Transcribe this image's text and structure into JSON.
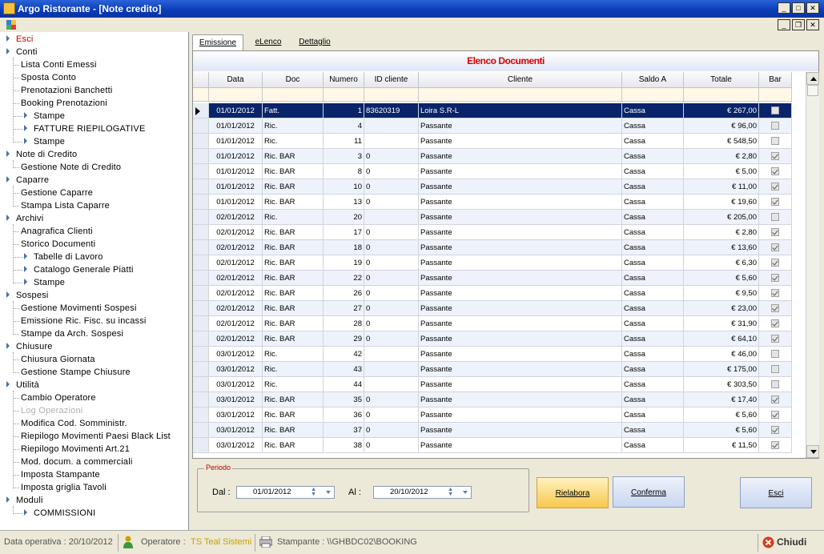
{
  "window": {
    "title": "Argo Ristorante - [Note credito]"
  },
  "sidebar": [
    {
      "label": "Esci",
      "level": 0,
      "arrow": true,
      "style": "red"
    },
    {
      "label": "Conti",
      "level": 0,
      "arrow": true
    },
    {
      "label": "Lista Conti Emessi",
      "level": 1
    },
    {
      "label": "Sposta Conto",
      "level": 1
    },
    {
      "label": "Prenotazioni Banchetti",
      "level": 1
    },
    {
      "label": "Booking Prenotazioni",
      "level": 1
    },
    {
      "label": "Stampe",
      "level": 2,
      "arrow": true
    },
    {
      "label": "FATTURE RIEPILOGATIVE",
      "level": 2,
      "arrow": true
    },
    {
      "label": "Stampe",
      "level": 2,
      "arrow": true
    },
    {
      "label": "Note di Credito",
      "level": 0,
      "arrow": true
    },
    {
      "label": "Gestione Note di Credito",
      "level": 1
    },
    {
      "label": "Caparre",
      "level": 0,
      "arrow": true
    },
    {
      "label": "Gestione Caparre",
      "level": 1
    },
    {
      "label": "Stampa Lista Caparre",
      "level": 1
    },
    {
      "label": "Archivi",
      "level": 0,
      "arrow": true
    },
    {
      "label": "Anagrafica Clienti",
      "level": 1
    },
    {
      "label": "Storico Documenti",
      "level": 1
    },
    {
      "label": "Tabelle di Lavoro",
      "level": 2,
      "arrow": true
    },
    {
      "label": "Catalogo Generale Piatti",
      "level": 2,
      "arrow": true
    },
    {
      "label": "Stampe",
      "level": 2,
      "arrow": true
    },
    {
      "label": "Sospesi",
      "level": 0,
      "arrow": true
    },
    {
      "label": "Gestione Movimenti Sospesi",
      "level": 1
    },
    {
      "label": "Emissione Ric. Fisc. su incassi",
      "level": 1
    },
    {
      "label": "Stampe da Arch. Sospesi",
      "level": 1
    },
    {
      "label": "Chiusure",
      "level": 0,
      "arrow": true
    },
    {
      "label": "Chiusura Giornata",
      "level": 1
    },
    {
      "label": "Gestione Stampe Chiusure",
      "level": 1
    },
    {
      "label": "Utilità",
      "level": 0,
      "arrow": true
    },
    {
      "label": "Cambio Operatore",
      "level": 1
    },
    {
      "label": "Log Operazioni",
      "level": 1,
      "style": "dim"
    },
    {
      "label": "Modifica Cod. Somministr.",
      "level": 1
    },
    {
      "label": "Riepilogo Movimenti Paesi Black List",
      "level": 1
    },
    {
      "label": "Riepilogo Movimenti Art.21",
      "level": 1
    },
    {
      "label": "Mod. docum. a commerciali",
      "level": 1
    },
    {
      "label": "Imposta Stampante",
      "level": 1
    },
    {
      "label": "Imposta griglia Tavoli",
      "level": 1
    },
    {
      "label": "Moduli",
      "level": 0,
      "arrow": true
    },
    {
      "label": "COMMISSIONI",
      "level": 2,
      "arrow": true
    }
  ],
  "tabs": [
    {
      "label": "Emissione",
      "active": true
    },
    {
      "label": "eLenco",
      "active": false
    },
    {
      "label": "Dettaglio",
      "active": false
    }
  ],
  "grid": {
    "title": "Elenco Documenti",
    "columns": [
      "Data",
      "Doc",
      "Numero",
      "ID cliente",
      "Cliente",
      "Saldo A",
      "Totale",
      "Bar"
    ],
    "rows": [
      {
        "data": "01/01/2012",
        "doc": "Fatt.",
        "numero": "1",
        "id": "83620319",
        "cliente": "Loira S.R-L",
        "saldo": "Cassa",
        "totale": "€ 267,00",
        "bar": false
      },
      {
        "data": "01/01/2012",
        "doc": "Ric.",
        "numero": "4",
        "id": "",
        "cliente": "Passante",
        "saldo": "Cassa",
        "totale": "€ 96,00",
        "bar": false
      },
      {
        "data": "01/01/2012",
        "doc": "Ric.",
        "numero": "11",
        "id": "",
        "cliente": "Passante",
        "saldo": "Cassa",
        "totale": "€ 548,50",
        "bar": false
      },
      {
        "data": "01/01/2012",
        "doc": "Ric. BAR",
        "numero": "3",
        "id": "0",
        "cliente": "Passante",
        "saldo": "Cassa",
        "totale": "€ 2,80",
        "bar": true
      },
      {
        "data": "01/01/2012",
        "doc": "Ric. BAR",
        "numero": "8",
        "id": "0",
        "cliente": "Passante",
        "saldo": "Cassa",
        "totale": "€ 5,00",
        "bar": true
      },
      {
        "data": "01/01/2012",
        "doc": "Ric. BAR",
        "numero": "10",
        "id": "0",
        "cliente": "Passante",
        "saldo": "Cassa",
        "totale": "€ 11,00",
        "bar": true
      },
      {
        "data": "01/01/2012",
        "doc": "Ric. BAR",
        "numero": "13",
        "id": "0",
        "cliente": "Passante",
        "saldo": "Cassa",
        "totale": "€ 19,60",
        "bar": true
      },
      {
        "data": "02/01/2012",
        "doc": "Ric.",
        "numero": "20",
        "id": "",
        "cliente": "Passante",
        "saldo": "Cassa",
        "totale": "€ 205,00",
        "bar": false
      },
      {
        "data": "02/01/2012",
        "doc": "Ric. BAR",
        "numero": "17",
        "id": "0",
        "cliente": "Passante",
        "saldo": "Cassa",
        "totale": "€ 2,80",
        "bar": true
      },
      {
        "data": "02/01/2012",
        "doc": "Ric. BAR",
        "numero": "18",
        "id": "0",
        "cliente": "Passante",
        "saldo": "Cassa",
        "totale": "€ 13,60",
        "bar": true
      },
      {
        "data": "02/01/2012",
        "doc": "Ric. BAR",
        "numero": "19",
        "id": "0",
        "cliente": "Passante",
        "saldo": "Cassa",
        "totale": "€ 6,30",
        "bar": true
      },
      {
        "data": "02/01/2012",
        "doc": "Ric. BAR",
        "numero": "22",
        "id": "0",
        "cliente": "Passante",
        "saldo": "Cassa",
        "totale": "€ 5,60",
        "bar": true
      },
      {
        "data": "02/01/2012",
        "doc": "Ric. BAR",
        "numero": "26",
        "id": "0",
        "cliente": "Passante",
        "saldo": "Cassa",
        "totale": "€ 9,50",
        "bar": true
      },
      {
        "data": "02/01/2012",
        "doc": "Ric. BAR",
        "numero": "27",
        "id": "0",
        "cliente": "Passante",
        "saldo": "Cassa",
        "totale": "€ 23,00",
        "bar": true
      },
      {
        "data": "02/01/2012",
        "doc": "Ric. BAR",
        "numero": "28",
        "id": "0",
        "cliente": "Passante",
        "saldo": "Cassa",
        "totale": "€ 31,90",
        "bar": true
      },
      {
        "data": "02/01/2012",
        "doc": "Ric. BAR",
        "numero": "29",
        "id": "0",
        "cliente": "Passante",
        "saldo": "Cassa",
        "totale": "€ 64,10",
        "bar": true
      },
      {
        "data": "03/01/2012",
        "doc": "Ric.",
        "numero": "42",
        "id": "",
        "cliente": "Passante",
        "saldo": "Cassa",
        "totale": "€ 46,00",
        "bar": false
      },
      {
        "data": "03/01/2012",
        "doc": "Ric.",
        "numero": "43",
        "id": "",
        "cliente": "Passante",
        "saldo": "Cassa",
        "totale": "€ 175,00",
        "bar": false
      },
      {
        "data": "03/01/2012",
        "doc": "Ric.",
        "numero": "44",
        "id": "",
        "cliente": "Passante",
        "saldo": "Cassa",
        "totale": "€ 303,50",
        "bar": false
      },
      {
        "data": "03/01/2012",
        "doc": "Ric. BAR",
        "numero": "35",
        "id": "0",
        "cliente": "Passante",
        "saldo": "Cassa",
        "totale": "€ 17,40",
        "bar": true
      },
      {
        "data": "03/01/2012",
        "doc": "Ric. BAR",
        "numero": "36",
        "id": "0",
        "cliente": "Passante",
        "saldo": "Cassa",
        "totale": "€ 5,60",
        "bar": true
      },
      {
        "data": "03/01/2012",
        "doc": "Ric. BAR",
        "numero": "37",
        "id": "0",
        "cliente": "Passante",
        "saldo": "Cassa",
        "totale": "€ 5,60",
        "bar": true
      },
      {
        "data": "03/01/2012",
        "doc": "Ric. BAR",
        "numero": "38",
        "id": "0",
        "cliente": "Passante",
        "saldo": "Cassa",
        "totale": "€ 11,50",
        "bar": true
      }
    ]
  },
  "period": {
    "legend": "Periodo",
    "from_label": "Dal :",
    "from_value": "01/01/2012",
    "to_label": "Al :",
    "to_value": "20/10/2012"
  },
  "buttons": {
    "rielabora": "Rielabora",
    "conferma": "Conferma",
    "esci": "Esci"
  },
  "status": {
    "data_operativa": "Data operativa : 20/10/2012",
    "operatore_label": "Operatore :",
    "operatore_value": "TS Teal Sistemi",
    "stampante": "Stampante : \\\\GHBDC02\\BOOKING",
    "chiudi": "Chiudi"
  },
  "colors": {
    "title_bar": "#0a3bb8",
    "grid_title": "#e00000",
    "selected_row": "#0a246a",
    "rielabora_button": "#f7c84a",
    "operatore_value": "#c8a000"
  },
  "icons": [
    "app-icon",
    "mdi-icon",
    "row-pointer-icon",
    "operator-icon",
    "printer-icon",
    "close-circle-icon"
  ]
}
